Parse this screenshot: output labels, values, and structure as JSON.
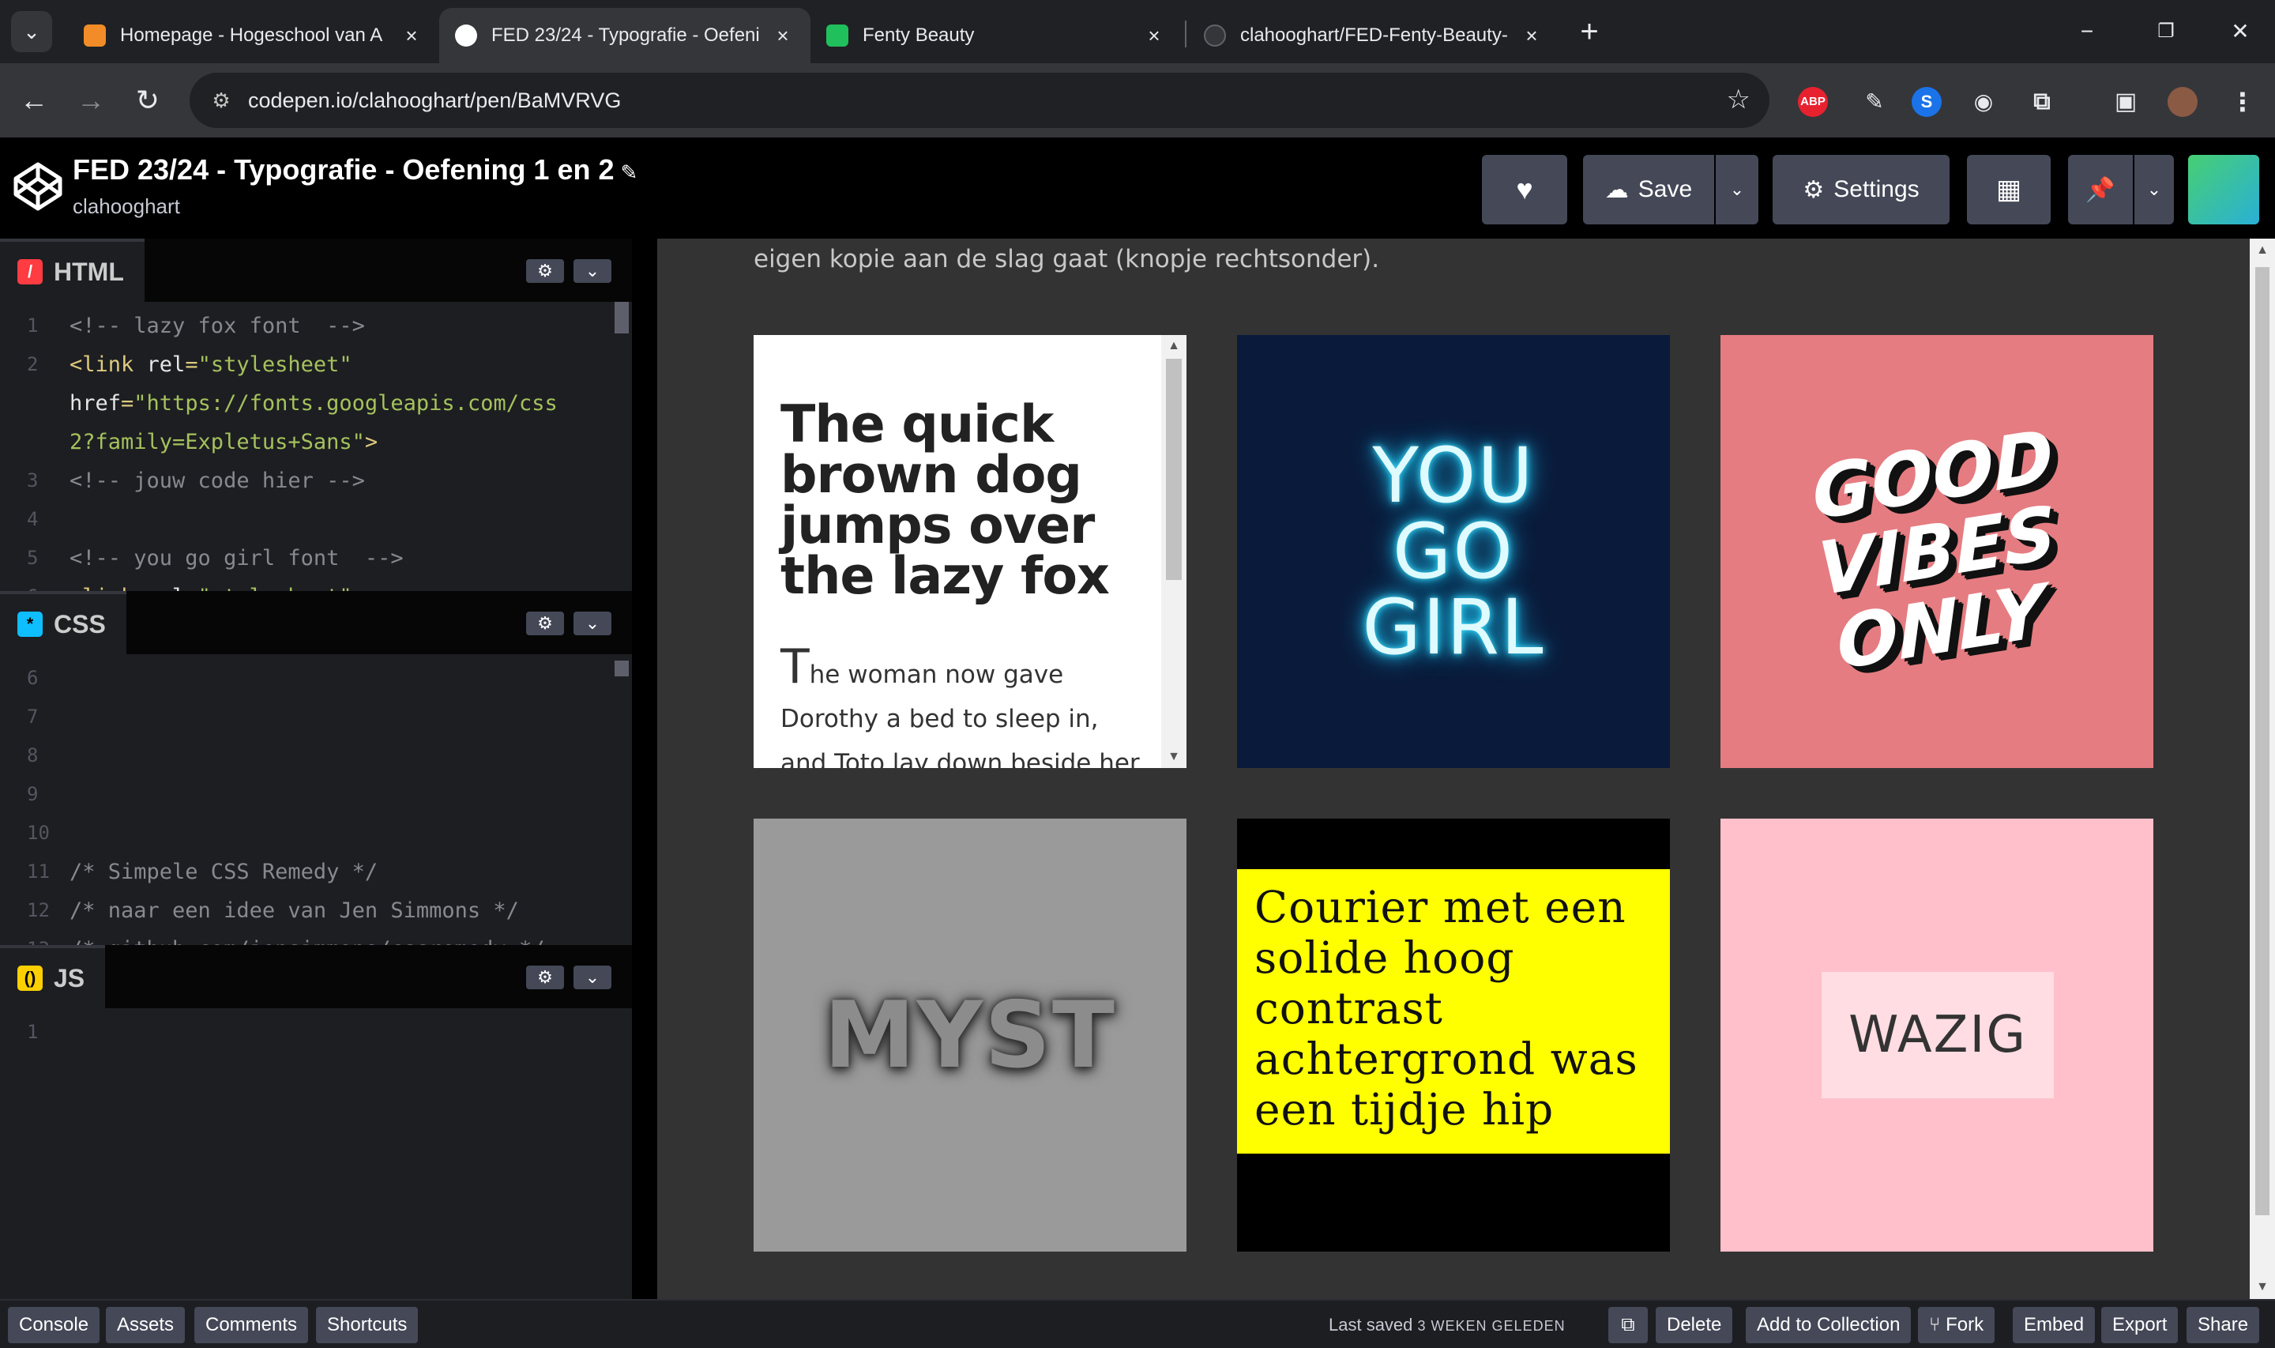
{
  "browser": {
    "tabs": [
      {
        "title": "Homepage - Hogeschool van A",
        "favicon_color": "#f28c28",
        "active": false
      },
      {
        "title": "FED 23/24 - Typografie - Oefeni",
        "favicon_color": "#ffffff",
        "active": true
      },
      {
        "title": "Fenty Beauty",
        "favicon_color": "#20c05c",
        "active": false
      },
      {
        "title": "clahooghart/FED-Fenty-Beauty-",
        "favicon_color": "#35363a",
        "active": false
      }
    ],
    "url": "codepen.io/clahooghart/pen/BaMVRVG",
    "extensions": {
      "abp": "ABP"
    }
  },
  "header": {
    "pen_title": "FED 23/24 - Typografie - Oefening 1 en 2",
    "author": "clahooghart",
    "save_label": "Save",
    "settings_label": "Settings"
  },
  "editors": {
    "html": {
      "label": "HTML",
      "lines": [
        {
          "n": "1",
          "parts": [
            {
              "t": "<!-- lazy fox font  -->",
              "c": "c-com"
            }
          ]
        },
        {
          "n": "2",
          "parts": [
            {
              "t": "<link ",
              "c": "c-tag"
            },
            {
              "t": "rel",
              "c": "c-attrname"
            },
            {
              "t": "=",
              "c": "c-punc"
            },
            {
              "t": "\"stylesheet\"",
              "c": "c-str"
            }
          ]
        },
        {
          "n": "",
          "parts": [
            {
              "t": "href",
              "c": "c-attrname"
            },
            {
              "t": "=",
              "c": "c-punc"
            },
            {
              "t": "\"https://fonts.googleapis.com/css",
              "c": "c-str"
            }
          ]
        },
        {
          "n": "",
          "parts": [
            {
              "t": "2?family=Expletus+Sans\"",
              "c": "c-str"
            },
            {
              "t": ">",
              "c": "c-tag"
            }
          ]
        },
        {
          "n": "3",
          "parts": [
            {
              "t": "<!-- jouw code hier -->",
              "c": "c-com"
            }
          ]
        },
        {
          "n": "4",
          "parts": []
        },
        {
          "n": "5",
          "parts": [
            {
              "t": "<!-- you go girl font  -->",
              "c": "c-com"
            }
          ]
        },
        {
          "n": "6",
          "parts": [
            {
              "t": "<link ",
              "c": "c-tag"
            },
            {
              "t": "rel",
              "c": "c-attrname"
            },
            {
              "t": "=",
              "c": "c-punc"
            },
            {
              "t": "\"stylesheet\"",
              "c": "c-str"
            }
          ]
        }
      ]
    },
    "css": {
      "label": "CSS",
      "lines": [
        {
          "n": "6",
          "parts": []
        },
        {
          "n": "7",
          "parts": []
        },
        {
          "n": "8",
          "parts": []
        },
        {
          "n": "9",
          "parts": []
        },
        {
          "n": "10",
          "parts": []
        },
        {
          "n": "11",
          "parts": [
            {
              "t": "/* Simpele CSS Remedy */",
              "c": "c-com"
            }
          ]
        },
        {
          "n": "12",
          "parts": [
            {
              "t": "/* naar een idee van Jen Simmons */",
              "c": "c-com"
            }
          ]
        },
        {
          "n": "13",
          "parts": [
            {
              "t": "/* github.com/jensimmons/cssremedy */",
              "c": "c-com"
            }
          ]
        }
      ]
    },
    "js": {
      "label": "JS",
      "lines": [
        {
          "n": "1",
          "parts": []
        }
      ]
    }
  },
  "preview": {
    "intro": "eigen kopie aan de slag gaat (knopje rechtsonder).",
    "lazy_title": "The quick brown dog jumps over the lazy fox",
    "lazy_dropcap": "T",
    "lazy_text": "he woman now gave Dorothy a bed to sleep in, and Toto lay down beside her",
    "yougo": [
      "YOU",
      "GO",
      "GIRL"
    ],
    "good": [
      "GOOD",
      "VIBES",
      "ONLY"
    ],
    "myst": "MYST",
    "courier": "Courier met een solide hoog contrast achtergrond was een tijdje hip",
    "wazig": "WAZIG"
  },
  "footer": {
    "console": "Console",
    "assets": "Assets",
    "comments": "Comments",
    "shortcuts": "Shortcuts",
    "last_saved": "Last saved",
    "last_saved_ago": "3 WEKEN GELEDEN",
    "delete": "Delete",
    "add_collection": "Add to Collection",
    "fork": "Fork",
    "embed": "Embed",
    "export": "Export",
    "share": "Share"
  },
  "colors": {
    "codepen_green": "#47cf73",
    "editor_bg": "#1d1e22",
    "button_bg": "#444857"
  }
}
